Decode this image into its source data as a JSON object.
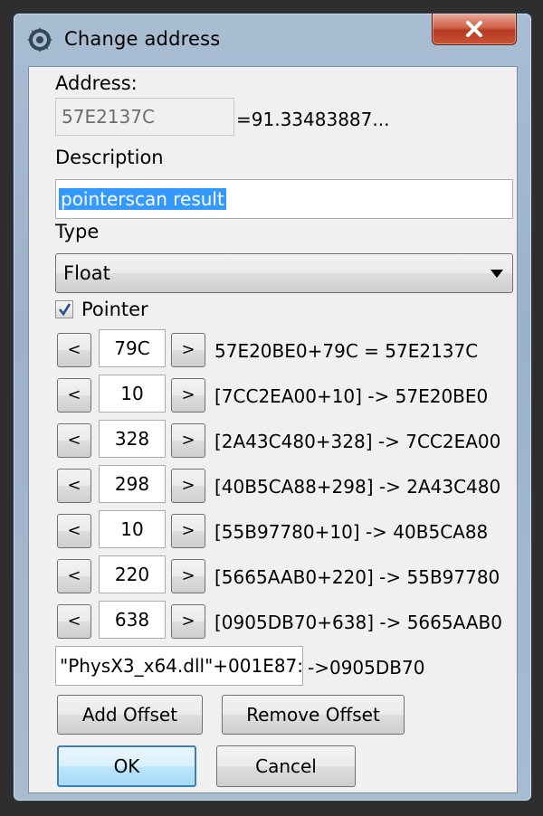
{
  "window": {
    "title": "Change address",
    "close_glyph": "x"
  },
  "address": {
    "label": "Address:",
    "value": "57E2137C",
    "result": "=91.33483887..."
  },
  "description": {
    "label": "Description",
    "value": "pointerscan result"
  },
  "type": {
    "label": "Type",
    "selected": "Float"
  },
  "pointer": {
    "checkbox_label": "Pointer",
    "checked": true
  },
  "offsets": [
    {
      "dec": "<",
      "value": "79C",
      "inc": ">",
      "chain": "57E20BE0+79C = 57E2137C"
    },
    {
      "dec": "<",
      "value": "10",
      "inc": ">",
      "chain": "[7CC2EA00+10] -> 57E20BE0"
    },
    {
      "dec": "<",
      "value": "328",
      "inc": ">",
      "chain": "[2A43C480+328] -> 7CC2EA00"
    },
    {
      "dec": "<",
      "value": "298",
      "inc": ">",
      "chain": "[40B5CA88+298] -> 2A43C480"
    },
    {
      "dec": "<",
      "value": "10",
      "inc": ">",
      "chain": "[55B97780+10] -> 40B5CA88"
    },
    {
      "dec": "<",
      "value": "220",
      "inc": ">",
      "chain": "[5665AAB0+220] -> 55B97780"
    },
    {
      "dec": "<",
      "value": "638",
      "inc": ">",
      "chain": "[0905DB70+638] -> 5665AAB0"
    }
  ],
  "base": {
    "value": "\"PhysX3_x64.dll\"+001E87:",
    "result": "->0905DB70"
  },
  "buttons": {
    "add_offset": "Add Offset",
    "remove_offset": "Remove Offset",
    "ok": "OK",
    "cancel": "Cancel"
  },
  "colors": {
    "selection": "#3399ff",
    "close_button": "#c9452c",
    "ok_border": "#3c7fb1"
  },
  "icons": {
    "app": "cheat-engine-icon",
    "close": "close-icon",
    "combo": "chevron-down-icon",
    "check": "checkmark-icon"
  }
}
